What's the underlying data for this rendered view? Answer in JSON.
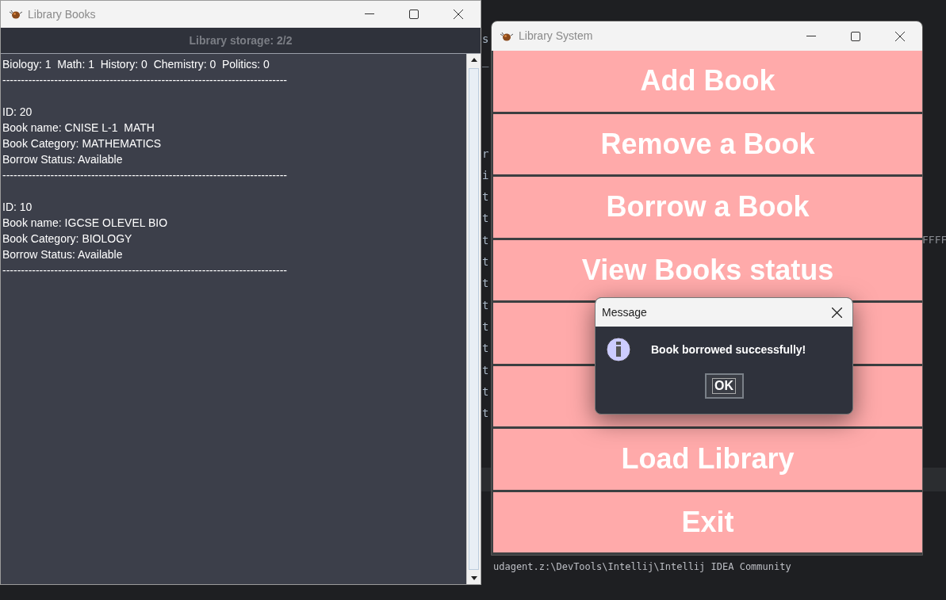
{
  "ide_background": {
    "code_fragments": [
      "s",
      "_",
      "r",
      "i",
      "t",
      "t",
      "t",
      "t",
      "t",
      "t",
      "t",
      "t",
      "t",
      "t",
      "t"
    ],
    "side_fragment": "FFFF",
    "console_line": "udagent.z:\\DevTools\\Intellij\\Intellij IDEA Community"
  },
  "books_window": {
    "title": "Library Books",
    "header": "Library storage: 2/2",
    "lines": [
      {
        "kind": "text",
        "text": "Biology: 1  Math: 1  History: 0  Chemistry: 0  Politics: 0"
      },
      {
        "kind": "text",
        "text": "-----------------------------------------------------------------------------"
      },
      {
        "kind": "blank"
      },
      {
        "kind": "text",
        "text": "ID: 20"
      },
      {
        "kind": "text",
        "text": "Book name: CNISE L-1  MATH"
      },
      {
        "kind": "text",
        "text": "Book Category: MATHEMATICS"
      },
      {
        "kind": "text",
        "text": "Borrow Status: Available"
      },
      {
        "kind": "text",
        "text": "-----------------------------------------------------------------------------"
      },
      {
        "kind": "blank"
      },
      {
        "kind": "text",
        "text": "ID: 10"
      },
      {
        "kind": "text",
        "text": "Book name: IGCSE OLEVEL BIO"
      },
      {
        "kind": "text",
        "text": "Book Category: BIOLOGY"
      },
      {
        "kind": "text",
        "text": "Borrow Status: Available"
      },
      {
        "kind": "text",
        "text": "-----------------------------------------------------------------------------"
      }
    ]
  },
  "system_window": {
    "title": "Library System",
    "buttons": [
      {
        "kind": "labeled",
        "label": "Add Book"
      },
      {
        "kind": "labeled",
        "label": "Remove a Book"
      },
      {
        "kind": "labeled",
        "label": "Borrow a Book"
      },
      {
        "kind": "labeled",
        "label": "View Books status"
      },
      {
        "kind": "label_hidden"
      },
      {
        "kind": "label_hidden"
      },
      {
        "kind": "labeled",
        "label": "Load Library"
      },
      {
        "kind": "labeled",
        "label": "Exit"
      }
    ]
  },
  "dialog": {
    "title": "Message",
    "message": "Book borrowed successfully!",
    "button": "OK"
  }
}
